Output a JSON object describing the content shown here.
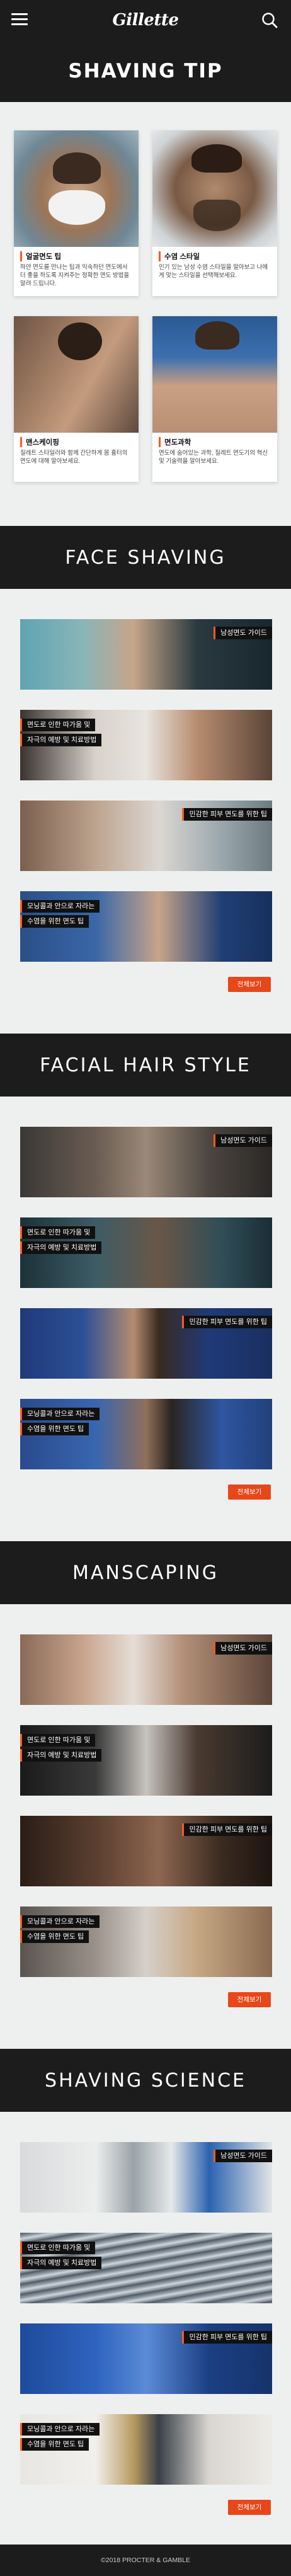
{
  "brand": {
    "logo_text": "Gillette",
    "accent": "#ff5a1f"
  },
  "header": {
    "menu_icon": "hamburger-icon",
    "search_icon": "search-icon"
  },
  "hero": {
    "title": "SHAVING TIP"
  },
  "tips": [
    {
      "title": "얼굴면도 팁",
      "desc": "하얀 면도를 만나는 팁과 익숙하던 면도에서 더 좋을 하도록 지켜주는 정확한 면도 방법을 알려 드립니다."
    },
    {
      "title": "수염 스타일",
      "desc": "인기 있는 남성 수염 스타일을 알아보고 나에게 맞는 스타일을 선택해보세요."
    },
    {
      "title": "맨스케이핑",
      "desc": "질레트 스타일러와 함께 간단하게 몸 흉터의 면도에 대해 알아보세요."
    },
    {
      "title": "면도과학",
      "desc": "면도에 숨어있는 과학, 질레트 면도기의 혁신 및 기술력을 알아보세요."
    }
  ],
  "sections": [
    {
      "title": "FACE SHAVING",
      "banners": [
        {
          "label1": "남성면도 가이드",
          "label2": ""
        },
        {
          "label1": "면도로 인한 따가움 및",
          "label2": "자극의 예방 및 치료방법"
        },
        {
          "label1": "민감한 피부 면도를 위한 팁",
          "label2": ""
        },
        {
          "label1": "모닝콜과 안으로 자라는",
          "label2": "수염을 위한 면도 팁"
        }
      ],
      "more": "전체보기"
    },
    {
      "title": "FACIAL HAIR STYLE",
      "banners": [
        {
          "label1": "남성면도 가이드",
          "label2": ""
        },
        {
          "label1": "면도로 인한 따가움 및",
          "label2": "자극의 예방 및 치료방법"
        },
        {
          "label1": "민감한 피부 면도를 위한 팁",
          "label2": ""
        },
        {
          "label1": "모닝콜과 안으로 자라는",
          "label2": "수염을 위한 면도 팁"
        }
      ],
      "more": "전체보기"
    },
    {
      "title": "MANSCAPING",
      "banners": [
        {
          "label1": "남성면도 가이드",
          "label2": ""
        },
        {
          "label1": "면도로 인한 따가움 및",
          "label2": "자극의 예방 및 치료방법"
        },
        {
          "label1": "민감한 피부 면도를 위한 팁",
          "label2": ""
        },
        {
          "label1": "모닝콜과 안으로 자라는",
          "label2": "수염을 위한 면도 팁"
        }
      ],
      "more": "전체보기"
    },
    {
      "title": "SHAVING SCIENCE",
      "banners": [
        {
          "label1": "남성면도 가이드",
          "label2": ""
        },
        {
          "label1": "면도로 인한 따가움 및",
          "label2": "자극의 예방 및 치료방법"
        },
        {
          "label1": "민감한 피부 면도를 위한 팁",
          "label2": ""
        },
        {
          "label1": "모닝콜과 안으로 자라는",
          "label2": "수염을 위한 면도 팁"
        }
      ],
      "more": "전체보기"
    }
  ],
  "footer": {
    "copyright": "©2018 PROCTER & GAMBLE"
  }
}
